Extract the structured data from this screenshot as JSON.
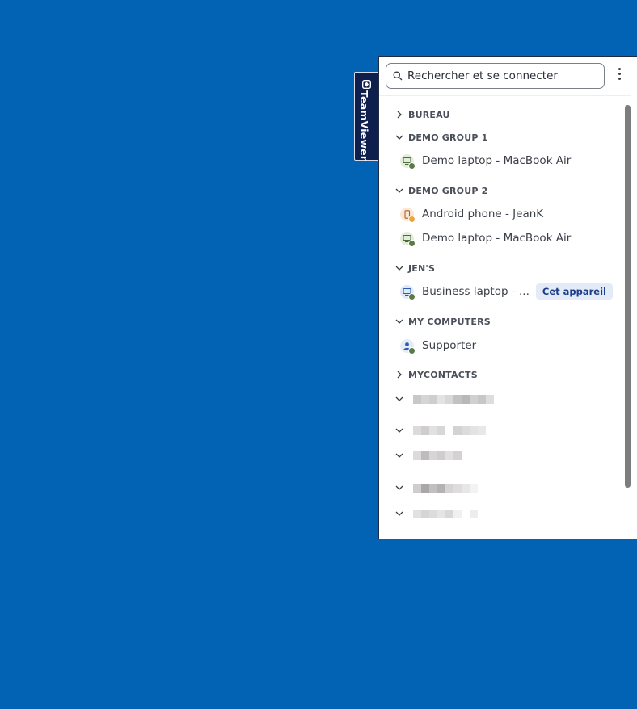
{
  "tab": {
    "label": "TeamViewer"
  },
  "search": {
    "placeholder": "Rechercher et se connecter",
    "value": ""
  },
  "groups": [
    {
      "label": "BUREAU",
      "expanded": false
    },
    {
      "label": "DEMO GROUP 1",
      "expanded": true,
      "items": [
        {
          "label": "Demo laptop - MacBook Air",
          "icon": "computer-icon",
          "status": "online"
        }
      ]
    },
    {
      "label": "DEMO GROUP 2",
      "expanded": true,
      "items": [
        {
          "label": "Android phone - JeanK",
          "icon": "phone-icon",
          "status": "away"
        },
        {
          "label": "Demo laptop - MacBook Air",
          "icon": "computer-icon",
          "status": "online"
        }
      ]
    },
    {
      "label": "JEN'S",
      "expanded": true,
      "items": [
        {
          "label": "Business laptop - ...",
          "icon": "computer-icon",
          "status": "online",
          "badge": "Cet appareil"
        }
      ]
    },
    {
      "label": "MY COMPUTERS",
      "expanded": true,
      "items": [
        {
          "label": "Supporter",
          "icon": "supporter-icon",
          "status": "online"
        }
      ]
    },
    {
      "label": "MYCONTACTS",
      "expanded": false
    }
  ],
  "colors": {
    "background": "#0263B4",
    "online": "#5B7A47",
    "away": "#F0A53A",
    "badge_bg": "#E4EBF7",
    "badge_text": "#1B3E8B"
  }
}
